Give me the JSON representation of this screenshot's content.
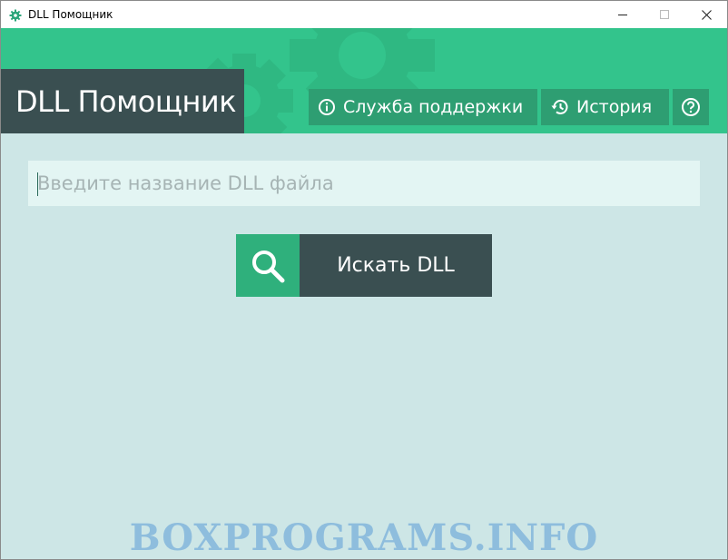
{
  "window": {
    "title": "DLL Помощник",
    "icon": "gear-icon"
  },
  "header": {
    "brand": "DLL Помощник",
    "support_label": "Служба поддержки",
    "history_label": "История",
    "help_icon": "question-icon"
  },
  "search": {
    "placeholder": "Введите название DLL файла",
    "value": "",
    "button_label": "Искать DLL",
    "button_icon": "search-icon"
  },
  "watermark": "BOXPROGRAMS.INFO",
  "colors": {
    "accent": "#33c48c",
    "dark": "#3a4f51",
    "button_green": "#2e9e72",
    "background": "#cde6e6",
    "input_bg": "#e3f5f3"
  }
}
